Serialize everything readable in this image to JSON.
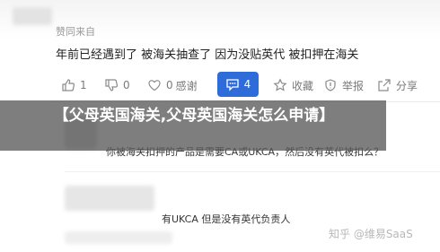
{
  "approval_text": "赞同来自",
  "answer_text": "年前已经遇到了 被海关抽查了 因为没贴英代 被扣押在海关",
  "actions": {
    "like_count": "1",
    "dislike_count": "0",
    "thanks_count": "0",
    "thanks_label": "感谢",
    "comment_count": "4",
    "collect_label": "收藏",
    "report_label": "举报",
    "share_label": "分享"
  },
  "overlay_title": "【父母英国海关,父母英国海关怎么申请】",
  "replies": [
    {
      "text": "你被海关扣押的产品是需要CA或UKCA，然后没有英代被扣么？"
    },
    {
      "text": "有UKCA 但是没有英代负责人"
    }
  ],
  "watermark": "知乎 @维易SaaS",
  "colors": {
    "accent": "#2e6dd9",
    "overlay": "#5a5a5a"
  },
  "icons": {
    "like": "thumbs-up-icon",
    "dislike": "thumbs-down-icon",
    "thanks": "heart-icon",
    "comment": "comment-icon",
    "collect": "star-icon",
    "report": "report-flag-icon",
    "share": "share-icon"
  }
}
